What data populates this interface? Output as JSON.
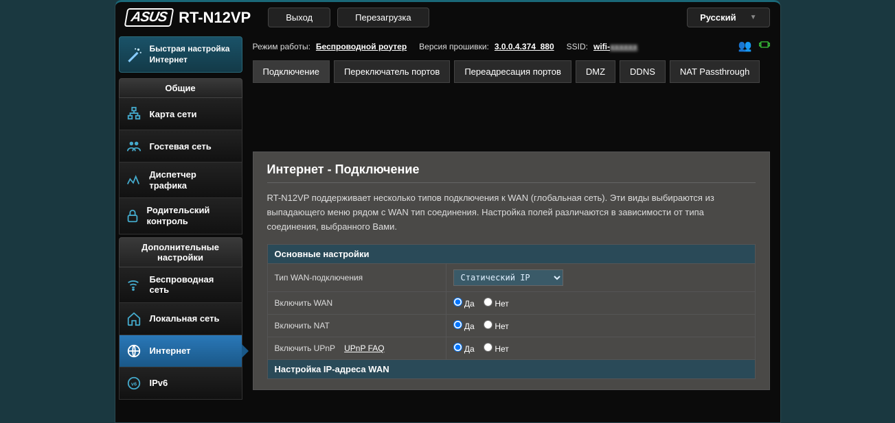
{
  "brand": "ASUS",
  "model": "RT-N12VP",
  "top_buttons": {
    "logout": "Выход",
    "reboot": "Перезагрузка"
  },
  "language": "Русский",
  "info": {
    "mode_label": "Режим работы:",
    "mode_value": "Беспроводной роутер",
    "fw_label": "Версия прошивки:",
    "fw_value": "3.0.0.4.374_880",
    "ssid_label": "SSID:",
    "ssid_value": "wifi-"
  },
  "qis": "Быстрая настройка Интернет",
  "section1": "Общие",
  "menu1": [
    "Карта сети",
    "Гостевая сеть",
    "Диспетчер трафика",
    "Родительский контроль"
  ],
  "section2": "Дополнительные настройки",
  "menu2": [
    "Беспроводная сеть",
    "Локальная сеть",
    "Интернет",
    "IPv6"
  ],
  "tabs": [
    "Подключение",
    "Переключатель портов",
    "Переадресация портов",
    "DMZ",
    "DDNS",
    "NAT Passthrough"
  ],
  "panel": {
    "title": "Интернет - Подключение",
    "desc": "RT-N12VP поддерживает несколько типов подключения к WAN (глобальная сеть). Эти виды выбираются из выпадающего меню рядом с WAN тип соединения. Настройка полей различаются в зависимости от типа соединения, выбранного Вами.",
    "section1": "Основные настройки",
    "rows": {
      "wan_type": "Тип WAN-подключения",
      "wan_type_value": "Статический IP",
      "enable_wan": "Включить WAN",
      "enable_nat": "Включить NAT",
      "enable_upnp": "Включить UPnP",
      "upnp_link": "UPnP FAQ",
      "yes": "Да",
      "no": "Нет"
    },
    "section2": "Настройка IP-адреса WAN"
  }
}
